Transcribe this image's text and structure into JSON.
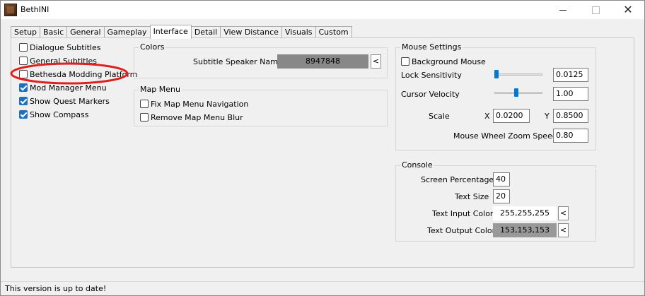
{
  "window": {
    "title": "BethINI"
  },
  "tabs": [
    {
      "label": "Setup"
    },
    {
      "label": "Basic"
    },
    {
      "label": "General"
    },
    {
      "label": "Gameplay"
    },
    {
      "label": "Interface"
    },
    {
      "label": "Detail"
    },
    {
      "label": "View Distance"
    },
    {
      "label": "Visuals"
    },
    {
      "label": "Custom"
    }
  ],
  "left_options": [
    {
      "label": "Dialogue Subtitles",
      "checked": false
    },
    {
      "label": "General Subtitles",
      "checked": false
    },
    {
      "label": "Bethesda Modding Platform",
      "checked": false
    },
    {
      "label": "Mod Manager Menu",
      "checked": true
    },
    {
      "label": "Show Quest Markers",
      "checked": true
    },
    {
      "label": "Show Compass",
      "checked": true
    }
  ],
  "colors": {
    "title": "Colors",
    "subtitle_speaker_label": "Subtitle Speaker Name",
    "subtitle_speaker_value": "8947848",
    "subtitle_speaker_color": "#888888",
    "picker_label": "<"
  },
  "map_menu": {
    "title": "Map Menu",
    "options": [
      {
        "label": "Fix Map Menu Navigation",
        "checked": false
      },
      {
        "label": "Remove Map Menu Blur",
        "checked": false
      }
    ]
  },
  "mouse": {
    "title": "Mouse Settings",
    "background_mouse_label": "Background Mouse",
    "background_mouse_checked": false,
    "lock_sensitivity_label": "Lock Sensitivity",
    "lock_sensitivity_value": "0.0125",
    "lock_sensitivity_slider": 0.0,
    "cursor_velocity_label": "Cursor Velocity",
    "cursor_velocity_value": "1.00",
    "cursor_velocity_slider": 0.45,
    "scale_label": "Scale",
    "x_label": "X",
    "x_value": "0.0200",
    "y_label": "Y",
    "y_value": "0.8500",
    "wheel_zoom_label": "Mouse Wheel Zoom Speed",
    "wheel_zoom_value": "0.80"
  },
  "console": {
    "title": "Console",
    "screen_percentage_label": "Screen Percentage",
    "screen_percentage_value": "40",
    "text_size_label": "Text Size",
    "text_size_value": "20",
    "text_input_color_label": "Text Input Color",
    "text_input_color_value": "255,255,255",
    "text_input_color": "#ffffff",
    "text_output_color_label": "Text Output Color",
    "text_output_color_value": "153,153,153",
    "text_output_color": "#999999",
    "picker_label": "<"
  },
  "status": {
    "text": "This version is up to date!"
  },
  "colors_theme": {
    "accent": "#0078d7",
    "annotation": "#e02020"
  }
}
